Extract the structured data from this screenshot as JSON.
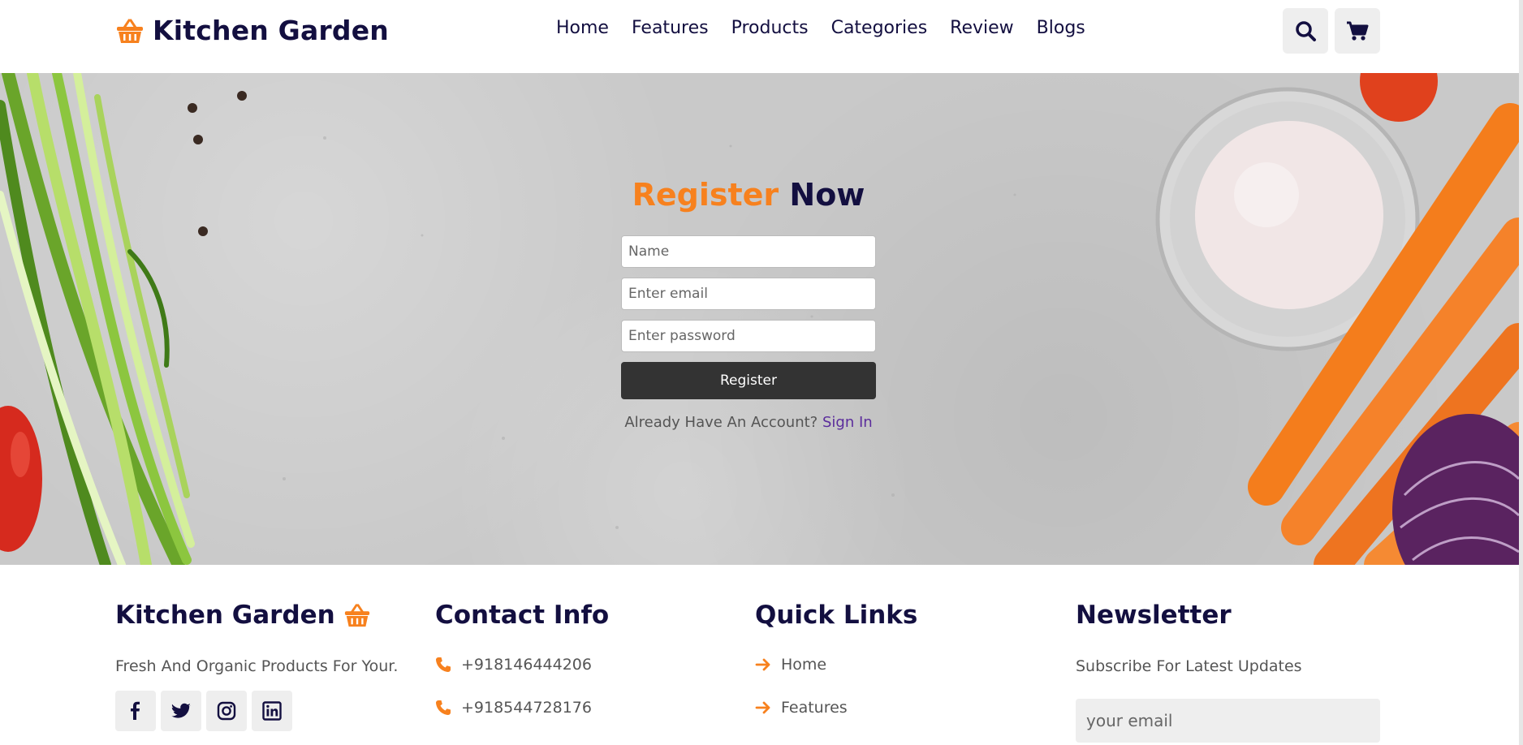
{
  "header": {
    "brand": "Kitchen Garden",
    "nav": [
      "Home",
      "Features",
      "Products",
      "Categories",
      "Review",
      "Blogs"
    ],
    "icons": [
      "search-icon",
      "cart-icon"
    ]
  },
  "colors": {
    "accent": "#f7811e",
    "navy": "#130f40",
    "button_dark": "#333333",
    "link_purple": "#5b2c9c"
  },
  "register": {
    "title_accent": "Register",
    "title_rest": "Now",
    "name_placeholder": "Name",
    "email_placeholder": "Enter email",
    "password_placeholder": "Enter password",
    "button_label": "Register",
    "already_text": "Already Have An Account?",
    "sign_in_label": "Sign In"
  },
  "footer": {
    "brand_title": "Kitchen Garden",
    "tagline": "Fresh And Organic Products For Your.",
    "social_icons": [
      "facebook-icon",
      "twitter-icon",
      "instagram-icon",
      "linkedin-icon"
    ],
    "contact_title": "Contact Info",
    "phones": [
      "+918146444206",
      "+918544728176"
    ],
    "quick_links_title": "Quick Links",
    "quick_links": [
      "Home",
      "Features"
    ],
    "newsletter_title": "Newsletter",
    "newsletter_text": "Subscribe For Latest Updates",
    "newsletter_placeholder": "your email"
  }
}
